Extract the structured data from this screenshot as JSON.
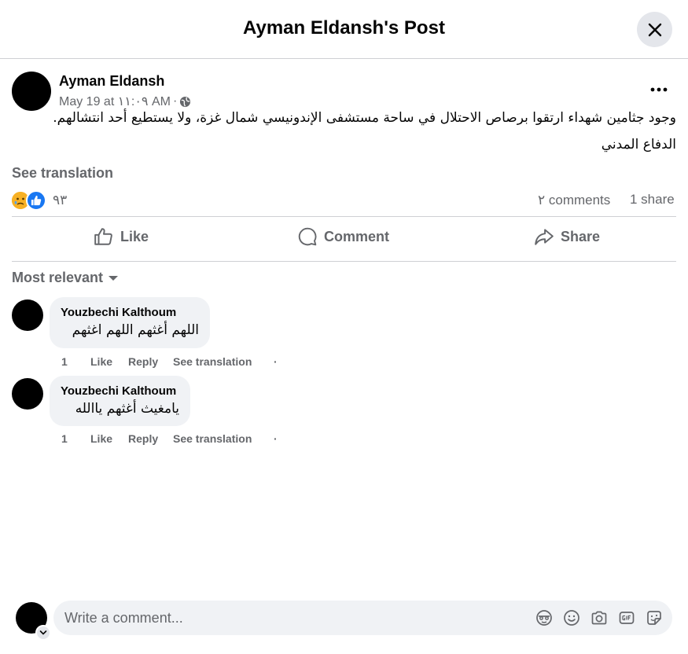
{
  "header": {
    "title": "Ayman Eldansh's Post"
  },
  "post": {
    "author": "Ayman Eldansh",
    "date": "May 19 at ١١:٠٩ AM",
    "meta_separator": "·",
    "text_line1": "وجود جثامين شهداء ارتقوا برصاص الاحتلال في ساحة مستشفى الإندونيسي شمال غزة، ولا يستطيع أحد انتشالهم.",
    "text_line2": "الدفاع المدني",
    "see_translation": "See translation",
    "reaction_count": "٩٣",
    "comments_count": "٢ comments",
    "shares_count": "1 share"
  },
  "actions": {
    "like": "Like",
    "comment": "Comment",
    "share": "Share"
  },
  "sort_label": "Most relevant",
  "comments": [
    {
      "author": "Youzbechi Kalthoum",
      "text": "اللهم أغثهم اللهم اغثهم",
      "time": "1",
      "like": "Like",
      "reply": "Reply",
      "see_translation": "See translation",
      "dot": "·"
    },
    {
      "author": "Youzbechi Kalthoum",
      "text": "يامغيث أغثهم ياالله",
      "time": "1",
      "like": "Like",
      "reply": "Reply",
      "see_translation": "See translation",
      "dot": "·"
    }
  ],
  "composer": {
    "placeholder": "Write a comment..."
  },
  "colors": {
    "like_blue": "#1877f2",
    "care_yellow": "#f7b125",
    "secondary_text": "#65676b"
  }
}
